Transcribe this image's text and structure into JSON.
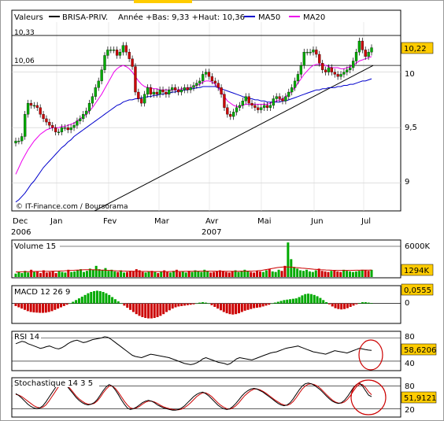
{
  "chart_data": [
    {
      "type": "candlestick",
      "panel": "price",
      "header": {
        "label": "Valeurs",
        "symbol": "BRISA-PRIV.",
        "range_text": "Année +Bas: 9,33 +Haut: 10,36",
        "ma50_label": "MA50",
        "ma20_label": "MA20"
      },
      "colors": {
        "up": "#00aa00",
        "down": "#cc0000",
        "ma50": "#0000cc",
        "ma20": "#ee00ee",
        "trend": "#000000",
        "accent": "#ffcc00"
      },
      "ylim": [
        8.75,
        10.55
      ],
      "yticks": [
        "10",
        "9,5",
        "9"
      ],
      "reference_lines": [
        {
          "value": 10.33,
          "label": "10,33"
        },
        {
          "value": 10.06,
          "label": "10,06"
        }
      ],
      "last_value": "10,22",
      "watermark": "© IT-Finance.com / Boursorama",
      "x_months": [
        "Dec",
        "Jan",
        "Fev",
        "Mar",
        "Avr",
        "Mai",
        "Jun",
        "Jul"
      ],
      "x_years": [
        "2006",
        "2007"
      ],
      "close": [
        9.38,
        9.38,
        9.42,
        9.62,
        9.72,
        9.7,
        9.7,
        9.68,
        9.62,
        9.58,
        9.55,
        9.52,
        9.5,
        9.46,
        9.46,
        9.5,
        9.5,
        9.48,
        9.5,
        9.52,
        9.56,
        9.58,
        9.62,
        9.65,
        9.72,
        9.78,
        9.86,
        9.92,
        10.02,
        10.15,
        10.2,
        10.2,
        10.2,
        10.15,
        10.18,
        10.24,
        10.18,
        10.12,
        10.05,
        9.82,
        9.76,
        9.72,
        9.8,
        9.86,
        9.8,
        9.82,
        9.8,
        9.84,
        9.82,
        9.8,
        9.84,
        9.86,
        9.84,
        9.82,
        9.84,
        9.86,
        9.84,
        9.86,
        9.88,
        9.9,
        9.92,
        9.98,
        10.0,
        9.96,
        9.92,
        9.9,
        9.86,
        9.8,
        9.68,
        9.62,
        9.6,
        9.64,
        9.68,
        9.7,
        9.74,
        9.78,
        9.72,
        9.7,
        9.68,
        9.66,
        9.68,
        9.7,
        9.68,
        9.7,
        9.76,
        9.78,
        9.76,
        9.74,
        9.78,
        9.82,
        9.86,
        9.92,
        9.98,
        10.06,
        10.18,
        10.18,
        10.18,
        10.2,
        10.16,
        10.08,
        10.02,
        10.0,
        10.04,
        10.0,
        9.98,
        9.96,
        9.98,
        10.0,
        10.02,
        10.04,
        10.1,
        10.18,
        10.28,
        10.2,
        10.14,
        10.18,
        10.22
      ],
      "ma50": [
        8.83,
        8.85,
        8.88,
        8.91,
        8.95,
        8.99,
        9.02,
        9.06,
        9.1,
        9.14,
        9.17,
        9.2,
        9.23,
        9.26,
        9.29,
        9.32,
        9.34,
        9.37,
        9.39,
        9.42,
        9.44,
        9.46,
        9.48,
        9.5,
        9.52,
        9.54,
        9.56,
        9.58,
        9.6,
        9.62,
        9.64,
        9.66,
        9.68,
        9.7,
        9.71,
        9.73,
        9.74,
        9.75,
        9.75,
        9.76,
        9.76,
        9.77,
        9.77,
        9.78,
        9.78,
        9.79,
        9.79,
        9.8,
        9.8,
        9.81,
        9.81,
        9.82,
        9.82,
        9.83,
        9.83,
        9.84,
        9.84,
        9.85,
        9.85,
        9.86,
        9.86,
        9.87,
        9.87,
        9.87,
        9.87,
        9.87,
        9.86,
        9.85,
        9.84,
        9.83,
        9.82,
        9.81,
        9.8,
        9.79,
        9.78,
        9.77,
        9.76,
        9.76,
        9.75,
        9.75,
        9.74,
        9.74,
        9.73,
        9.73,
        9.73,
        9.73,
        9.73,
        9.74,
        9.74,
        9.75,
        9.76,
        9.77,
        9.78,
        9.79,
        9.8,
        9.81,
        9.82,
        9.83,
        9.84,
        9.84,
        9.85,
        9.85,
        9.86,
        9.86,
        9.86,
        9.87,
        9.87,
        9.88,
        9.88,
        9.89,
        9.89,
        9.9,
        9.91,
        9.92,
        9.92,
        9.93,
        9.94
      ],
      "ma20": [
        9.08,
        9.14,
        9.2,
        9.25,
        9.3,
        9.34,
        9.38,
        9.41,
        9.44,
        9.46,
        9.48,
        9.49,
        9.5,
        9.5,
        9.5,
        9.51,
        9.51,
        9.52,
        9.53,
        9.54,
        9.56,
        9.58,
        9.6,
        9.62,
        9.65,
        9.68,
        9.72,
        9.76,
        9.8,
        9.85,
        9.9,
        9.95,
        10.0,
        10.03,
        10.05,
        10.06,
        10.05,
        10.03,
        10.0,
        9.96,
        9.92,
        9.89,
        9.87,
        9.86,
        9.86,
        9.85,
        9.85,
        9.84,
        9.84,
        9.84,
        9.84,
        9.84,
        9.84,
        9.84,
        9.85,
        9.85,
        9.86,
        9.86,
        9.87,
        9.88,
        9.89,
        9.91,
        9.92,
        9.92,
        9.91,
        9.89,
        9.86,
        9.82,
        9.78,
        9.74,
        9.72,
        9.7,
        9.69,
        9.69,
        9.7,
        9.71,
        9.71,
        9.71,
        9.71,
        9.71,
        9.71,
        9.71,
        9.71,
        9.72,
        9.73,
        9.74,
        9.75,
        9.76,
        9.78,
        9.8,
        9.83,
        9.86,
        9.9,
        9.94,
        9.98,
        10.01,
        10.04,
        10.06,
        10.07,
        10.07,
        10.07,
        10.06,
        10.05,
        10.04,
        10.04,
        10.04,
        10.03,
        10.03,
        10.04,
        10.05,
        10.06,
        10.08,
        10.1,
        10.11,
        10.12,
        10.13,
        10.14
      ]
    },
    {
      "type": "bar",
      "panel": "volume",
      "title": "Volume 15",
      "yticks": [
        "6000K"
      ],
      "last_value": "1294K",
      "ylim": [
        0,
        6500
      ],
      "values": [
        600,
        900,
        700,
        1100,
        800,
        1300,
        900,
        1000,
        700,
        1200,
        800,
        900,
        1100,
        700,
        1000,
        900,
        800,
        1300,
        900,
        1000,
        1200,
        1400,
        900,
        1100,
        1500,
        1300,
        2000,
        1400,
        1200,
        1600,
        1100,
        1300,
        1000,
        900,
        1200,
        800,
        900,
        1100,
        1000,
        1400,
        1200,
        900,
        800,
        1000,
        1100,
        900,
        700,
        1000,
        1200,
        900,
        800,
        1100,
        1300,
        900,
        1000,
        800,
        1100,
        900,
        1200,
        1000,
        900,
        1300,
        1100,
        800,
        900,
        1000,
        1200,
        1100,
        900,
        800,
        1000,
        1200,
        900,
        1100,
        1300,
        1000,
        900,
        800,
        1100,
        1000,
        900,
        1200,
        1400,
        1000,
        900,
        1300,
        1100,
        2000,
        6200,
        3200,
        1800,
        1500,
        1200,
        1100,
        1300,
        1000,
        900,
        1200,
        1500,
        1100,
        1000,
        900,
        1100,
        1200,
        1000,
        900,
        1300,
        1100,
        1000,
        900,
        1000,
        1100,
        1294,
        1200,
        1100,
        1294
      ],
      "ma": [
        900,
        920,
        930,
        950,
        960,
        980,
        990,
        1000,
        1000,
        1010,
        1020,
        1030,
        1050,
        1060,
        1080,
        1100,
        1120,
        1150,
        1180,
        1200,
        1230,
        1260,
        1280,
        1300,
        1310,
        1300,
        1290,
        1270,
        1250,
        1230,
        1200,
        1180,
        1150,
        1120,
        1100,
        1080,
        1060,
        1050,
        1040,
        1030,
        1020,
        1010,
        1000,
        1000,
        990,
        980,
        980,
        970,
        970,
        970,
        980,
        990,
        1000,
        1000,
        1010,
        1010,
        1020,
        1030,
        1030,
        1040,
        1040,
        1050,
        1050,
        1050,
        1050,
        1040,
        1040,
        1030,
        1030,
        1020,
        1020,
        1020,
        1030,
        1030,
        1040,
        1050,
        1060,
        1060,
        1080,
        1100,
        1150,
        1200,
        1300,
        1400,
        1500,
        1600,
        1700,
        1750,
        1800,
        1800,
        1780,
        1750,
        1700,
        1650,
        1600,
        1550,
        1500,
        1450,
        1400,
        1350,
        1300,
        1280,
        1260,
        1240,
        1220,
        1200,
        1190,
        1180,
        1180,
        1180,
        1190,
        1200,
        1210,
        1220,
        1230,
        1240,
        1250,
        1260
      ]
    },
    {
      "type": "bar",
      "panel": "macd",
      "title": "MACD 12 26 9",
      "yticks": [
        "0"
      ],
      "last_value": "0,0555",
      "ylim": [
        -0.09,
        0.08
      ],
      "values": [
        -0.012,
        -0.018,
        -0.024,
        -0.03,
        -0.036,
        -0.04,
        -0.042,
        -0.043,
        -0.044,
        -0.044,
        -0.043,
        -0.04,
        -0.036,
        -0.03,
        -0.024,
        -0.018,
        -0.012,
        -0.006,
        0.0,
        0.008,
        0.016,
        0.024,
        0.032,
        0.04,
        0.048,
        0.054,
        0.058,
        0.06,
        0.058,
        0.054,
        0.048,
        0.04,
        0.03,
        0.02,
        0.01,
        0.0,
        -0.01,
        -0.02,
        -0.03,
        -0.04,
        -0.05,
        -0.058,
        -0.064,
        -0.068,
        -0.07,
        -0.07,
        -0.068,
        -0.064,
        -0.058,
        -0.05,
        -0.04,
        -0.032,
        -0.024,
        -0.018,
        -0.014,
        -0.012,
        -0.01,
        -0.008,
        -0.006,
        -0.004,
        0.0,
        0.004,
        0.006,
        0.004,
        0.0,
        -0.008,
        -0.016,
        -0.024,
        -0.032,
        -0.04,
        -0.046,
        -0.05,
        -0.052,
        -0.05,
        -0.046,
        -0.04,
        -0.034,
        -0.03,
        -0.026,
        -0.022,
        -0.02,
        -0.018,
        -0.014,
        -0.01,
        -0.006,
        0.0,
        0.004,
        0.008,
        0.012,
        0.016,
        0.018,
        0.02,
        0.022,
        0.024,
        0.03,
        0.038,
        0.044,
        0.046,
        0.044,
        0.04,
        0.034,
        0.026,
        0.016,
        0.006,
        -0.004,
        -0.014,
        -0.022,
        -0.026,
        -0.028,
        -0.026,
        -0.022,
        -0.016,
        -0.01,
        -0.004,
        0.002,
        0.006,
        0.006,
        0.004,
        0.002
      ]
    },
    {
      "type": "line",
      "panel": "rsi",
      "title": "RSI 14",
      "yticks": [
        "80",
        "40"
      ],
      "last_value": "58,6206",
      "ylim": [
        25,
        90
      ],
      "values": [
        70,
        72,
        74,
        73,
        70,
        68,
        66,
        64,
        62,
        63,
        65,
        66,
        64,
        62,
        61,
        63,
        66,
        70,
        73,
        75,
        76,
        74,
        72,
        73,
        75,
        77,
        78,
        79,
        80,
        82,
        81,
        78,
        74,
        70,
        66,
        62,
        58,
        54,
        50,
        48,
        47,
        46,
        48,
        50,
        52,
        51,
        50,
        49,
        48,
        47,
        46,
        44,
        42,
        40,
        38,
        36,
        35,
        34,
        35,
        37,
        40,
        44,
        46,
        44,
        42,
        40,
        38,
        37,
        36,
        34,
        36,
        40,
        44,
        46,
        45,
        44,
        43,
        42,
        44,
        46,
        48,
        50,
        52,
        54,
        55,
        56,
        58,
        60,
        62,
        63,
        64,
        65,
        66,
        64,
        62,
        60,
        58,
        56,
        55,
        54,
        53,
        52,
        54,
        56,
        58,
        57,
        56,
        55,
        54,
        56,
        58,
        60,
        62,
        61,
        60,
        59,
        58.62
      ]
    },
    {
      "type": "line",
      "panel": "stochastic",
      "title": "Stochastique 14 3 5",
      "yticks": [
        "80",
        "20"
      ],
      "last_value": "51,9121",
      "ylim": [
        0,
        100
      ],
      "k": [
        60,
        55,
        48,
        40,
        32,
        26,
        22,
        20,
        22,
        28,
        38,
        50,
        62,
        74,
        84,
        88,
        86,
        80,
        70,
        60,
        50,
        42,
        36,
        32,
        30,
        32,
        36,
        44,
        56,
        68,
        78,
        84,
        80,
        70,
        58,
        44,
        32,
        22,
        18,
        20,
        24,
        30,
        36,
        40,
        42,
        40,
        36,
        30,
        26,
        22,
        20,
        18,
        16,
        16,
        18,
        22,
        28,
        36,
        44,
        52,
        58,
        62,
        64,
        60,
        54,
        46,
        38,
        30,
        24,
        20,
        18,
        20,
        26,
        34,
        44,
        54,
        62,
        68,
        72,
        74,
        72,
        68,
        64,
        58,
        52,
        46,
        40,
        34,
        30,
        28,
        30,
        36,
        46,
        58,
        70,
        80,
        86,
        88,
        86,
        82,
        76,
        70,
        62,
        54,
        46,
        40,
        36,
        34,
        36,
        42,
        52,
        64,
        76,
        84,
        88,
        80,
        68,
        56,
        51.91
      ],
      "d": [
        58,
        56,
        52,
        46,
        40,
        34,
        28,
        24,
        22,
        24,
        30,
        40,
        52,
        64,
        76,
        84,
        86,
        82,
        74,
        64,
        54,
        46,
        40,
        35,
        32,
        32,
        34,
        40,
        50,
        62,
        72,
        80,
        80,
        74,
        64,
        52,
        40,
        30,
        22,
        20,
        22,
        26,
        32,
        37,
        40,
        40,
        38,
        34,
        29,
        25,
        22,
        20,
        18,
        17,
        17,
        19,
        23,
        29,
        36,
        44,
        52,
        58,
        62,
        62,
        58,
        52,
        44,
        36,
        29,
        24,
        20,
        19,
        22,
        28,
        36,
        46,
        55,
        62,
        68,
        72,
        72,
        70,
        66,
        61,
        55,
        49,
        43,
        38,
        33,
        30,
        29,
        32,
        39,
        49,
        61,
        72,
        80,
        85,
        86,
        84,
        80,
        74,
        66,
        58,
        50,
        43,
        38,
        35,
        35,
        38,
        45,
        55,
        67,
        78,
        85,
        84,
        76,
        65,
        57
      ]
    }
  ]
}
